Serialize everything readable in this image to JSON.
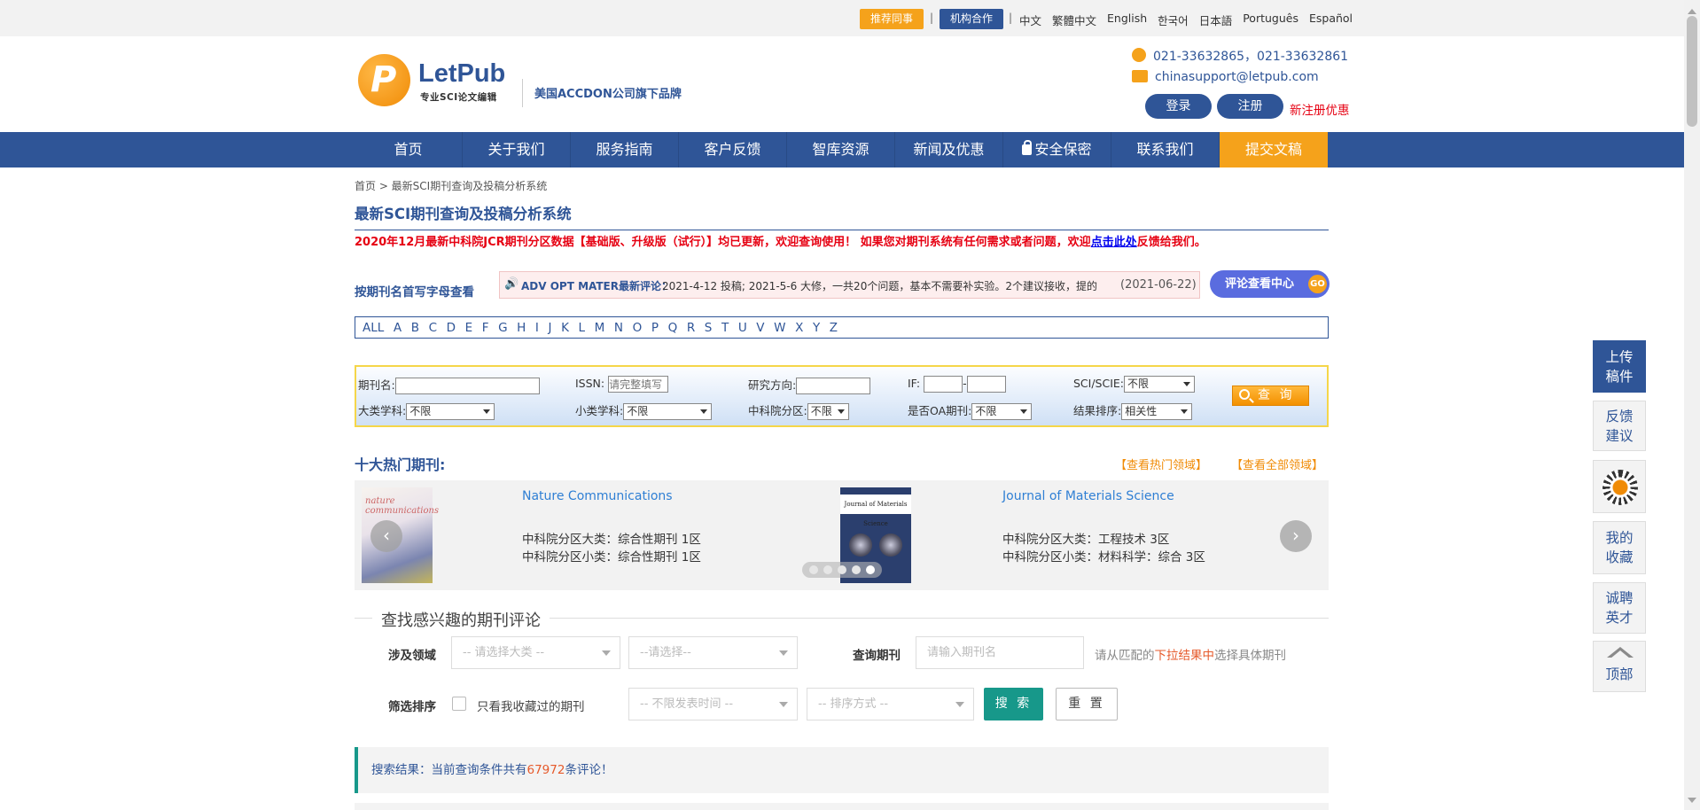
{
  "topbar": {
    "recommend_label": "推荐同事",
    "cooperate_label": "机构合作",
    "separator": "|",
    "languages": [
      "中文",
      "繁體中文",
      "English",
      "한국어",
      "日本語",
      "Português",
      "Español"
    ]
  },
  "header": {
    "logo_letter": "P",
    "logo_name": "LetPub",
    "logo_sub": "专业SCI论文编辑",
    "brand_tag": "美国ACCDON公司旗下品牌",
    "phone": "021-33632865，021-33632861",
    "email": "chinasupport@letpub.com",
    "login_label": "登录",
    "register_label": "注册",
    "register_promo": "新注册优惠"
  },
  "nav": {
    "items": [
      "首页",
      "关于我们",
      "服务指南",
      "客户反馈",
      "智库资源",
      "新闻及优惠",
      "安全保密",
      "联系我们",
      "提交文稿"
    ]
  },
  "breadcrumb": "首页 > 最新SCI期刊查询及投稿分析系统",
  "page_title": "最新SCI期刊查询及投稿分析系统",
  "notice": {
    "text": "2020年12月最新中科院JCR期刊分区数据【基础版、升级版（试行）】均已更新，欢迎查询使用！ 如果您对期刊系统有任何需求或者问题，欢迎",
    "link": "点击此处",
    "tail": "反馈给我们。"
  },
  "alpha": {
    "label": "按期刊名首写字母查看",
    "letters": [
      "ALL",
      "A",
      "B",
      "C",
      "D",
      "E",
      "F",
      "G",
      "H",
      "I",
      "J",
      "K",
      "L",
      "M",
      "N",
      "O",
      "P",
      "Q",
      "R",
      "S",
      "T",
      "U",
      "V",
      "W",
      "X",
      "Y",
      "Z"
    ]
  },
  "ticker": {
    "lead": "ADV OPT MATER最新评论：",
    "body": "2021-4-12 投稿; 2021-5-6 大修，一共20个问题，基本不需要补实验。2个建议接收，提的",
    "date": "(2021-06-22)"
  },
  "review_center": {
    "label": "评论查看中心",
    "go": "GO"
  },
  "search": {
    "journal_name": "期刊名:",
    "issn": "ISSN:",
    "issn_placeholder": "请完整填写",
    "research": "研究方向:",
    "if": "IF:",
    "if_sep": "-",
    "sci": "SCI/SCIE:",
    "sci_value": "不限",
    "major": "大类学科:",
    "major_value": "不限",
    "minor": "小类学科:",
    "minor_value": "不限",
    "cas": "中科院分区:",
    "cas_value": "不限",
    "oa": "是否OA期刊:",
    "oa_value": "不限",
    "sort": "结果排序:",
    "sort_value": "相关性",
    "query_label": "查 询"
  },
  "hot": {
    "title": "十大热门期刊:",
    "link_hot": "【查看热门领域】",
    "link_all": "【查看全部领域】",
    "journals": [
      {
        "cover_text": "nature communications",
        "name": "Nature Communications",
        "major": "中科院分区大类：综合性期刊 1区",
        "minor": "中科院分区小类：综合性期刊 1区"
      },
      {
        "cover_text": "Journal of Materials Science",
        "name": "Journal of Materials Science",
        "major": "中科院分区大类：工程技术 3区",
        "minor": "中科院分区小类：材料科学：综合 3区"
      }
    ],
    "prev": "‹",
    "next": "›"
  },
  "reviews": {
    "title": "查找感兴趣的期刊评论",
    "field_label": "涉及领域",
    "field_major_placeholder": "-- 请选择大类 --",
    "field_minor_placeholder": "--请选择--",
    "journal_label": "查询期刊",
    "journal_placeholder": "请输入期刊名",
    "hint_pre": "请从匹配的",
    "hint_hl": "下拉结果中",
    "hint_post": "选择具体期刊",
    "filter_label": "筛选排序",
    "only_fav": "只看我收藏过的期刊",
    "time_placeholder": "-- 不限发表时间 --",
    "order_placeholder": "-- 排序方式 --",
    "search_label": "搜 索",
    "reset_label": "重 置"
  },
  "result": {
    "prefix": "搜索结果：当前查询条件共有",
    "count": "67972",
    "suffix": "条评论！"
  },
  "float": {
    "upload": [
      "上传",
      "稿件"
    ],
    "feedback": [
      "反馈",
      "建议"
    ],
    "favorites": [
      "我的",
      "收藏"
    ],
    "jobs": [
      "诚聘",
      "英才"
    ],
    "top": "顶部"
  },
  "colors": {
    "brand_blue": "#2f5597",
    "accent_orange": "#f5a21b",
    "alert_red": "#e60012",
    "teal": "#17988a"
  }
}
